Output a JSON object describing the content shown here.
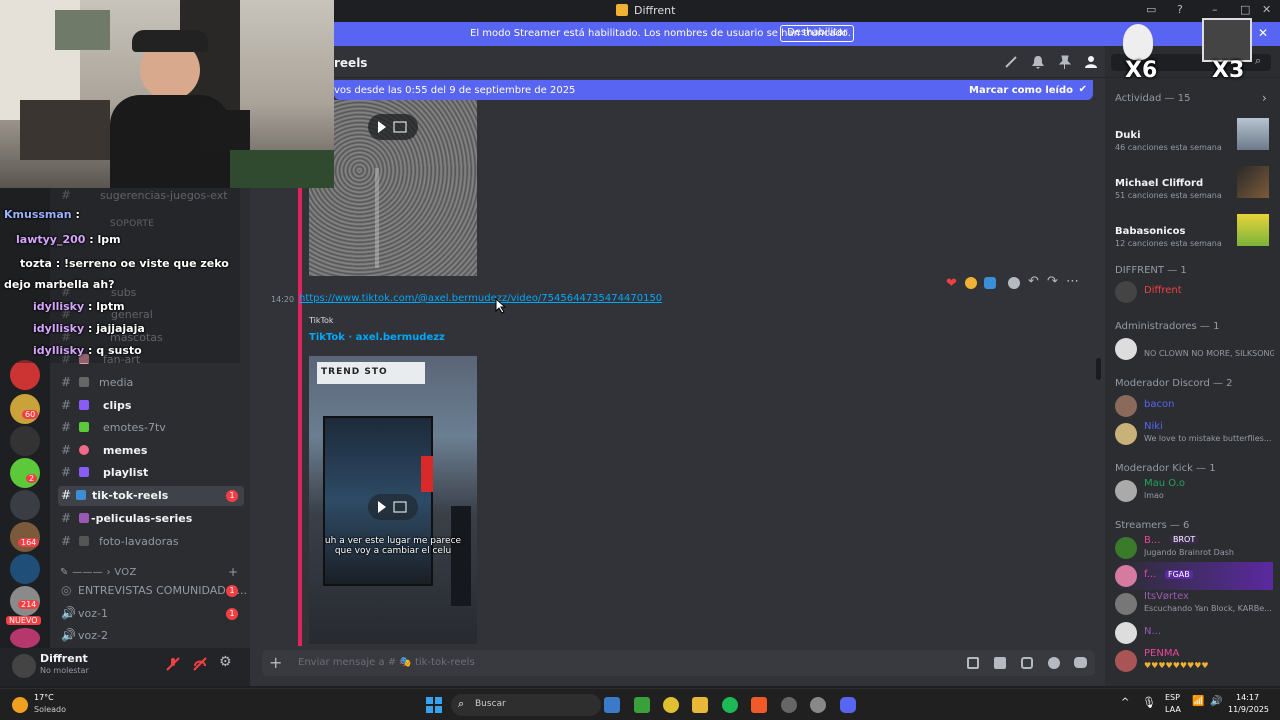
{
  "window": {
    "title": "Diffrent"
  },
  "banner": {
    "message": "El modo Streamer está habilitado. Los nombres de usuario se han truncado.",
    "button": "Deshabilitar"
  },
  "channel_header": {
    "name": "reels"
  },
  "new_messages": {
    "text": "vos desde las 0:55 del 9 de septiembre de 2025",
    "action": "Marcar como leído"
  },
  "message": {
    "time": "14:20",
    "link": "https://www.tiktok.com/@axel.bermudezz/video/7545644735474470150",
    "embed_provider": "TikTok",
    "embed_title": "TikTok · axel.bermudezz",
    "video_caption_line1": "uh a ver este lugar me parece",
    "video_caption_line2": "que voy a cambiar el celu"
  },
  "composer": {
    "placeholder": "Enviar mensaje a # 🎭 tik-tok-reels"
  },
  "overlay_chat": [
    {
      "user": "Kmussman",
      "text": ":"
    },
    {
      "user": "lawtyy_200",
      "text": ": lpm"
    },
    {
      "user": "tozta",
      "text": ": !serreno oe      viste que zeko"
    },
    {
      "user": "",
      "text": "dejo marbella ah?"
    },
    {
      "user": "idyllisky",
      "text": ": lptm"
    },
    {
      "user": "idyllisky",
      "text": ": jajjajaja"
    },
    {
      "user": "idyllisky",
      "text": ": q susto"
    }
  ],
  "sidebar": {
    "cat_soporte": "SOPORTE",
    "cat_voz": "VOZ",
    "channels": [
      {
        "label": "sugerencias-juegos-ext",
        "bold": false
      },
      {
        "label": "subs",
        "bold": false
      },
      {
        "label": "general",
        "bold": false
      },
      {
        "label": "mascotas",
        "bold": false
      },
      {
        "label": "fan-art",
        "bold": false
      },
      {
        "label": "media",
        "bold": false
      },
      {
        "label": "clips",
        "bold": true
      },
      {
        "label": "emotes-7tv",
        "bold": false
      },
      {
        "label": "memes",
        "bold": true
      },
      {
        "label": "playlist",
        "bold": true
      },
      {
        "label": "tik-tok-reels",
        "bold": true
      },
      {
        "label": "-peliculas-series",
        "bold": true
      },
      {
        "label": "foto-lavadoras",
        "bold": false
      }
    ],
    "voice": [
      {
        "label": "ENTREVISTAS COMUNIDAD K...",
        "badge": "1"
      },
      {
        "label": "voz-1",
        "badge": "1"
      },
      {
        "label": "voz-2",
        "badge": ""
      }
    ],
    "unread_badge": "1"
  },
  "user_panel": {
    "name": "Diffrent",
    "status": "No molestar"
  },
  "rail_badges": {
    "b1": "60",
    "b2": "2",
    "b3": "164",
    "b4": "214",
    "nuevo": "NUEVO"
  },
  "members": {
    "activity_header": "Actividad — 15",
    "activities": [
      {
        "name": "Duki",
        "sub": "46 canciones esta semana"
      },
      {
        "name": "Michael Clifford",
        "sub": "51 canciones esta semana"
      },
      {
        "name": "Babasonicos",
        "sub": "12 canciones esta semana"
      }
    ],
    "sections": [
      {
        "title": "DIFFRENT — 1",
        "people": [
          {
            "name": "Diffrent",
            "status": "",
            "color": "#f23f43"
          }
        ]
      },
      {
        "title": "Administradores — 1",
        "people": [
          {
            "name": "",
            "status": "NO CLOWN NO MORE, SILKSONG ...",
            "color": "#5865f2"
          }
        ]
      },
      {
        "title": "Moderador Discord — 2",
        "people": [
          {
            "name": "bacon",
            "status": "",
            "color": "#5865f2"
          },
          {
            "name": "Niki",
            "status": "We love to mistake butterflies...",
            "color": "#5865f2"
          }
        ]
      },
      {
        "title": "Moderador Kick — 1",
        "people": [
          {
            "name": "Mau O.o",
            "status": "lmao",
            "color": "#23a55a"
          }
        ]
      },
      {
        "title": "Streamers — 6",
        "people": [
          {
            "name": "B...",
            "status": "Jugando Brainrot Dash",
            "color": "#eb459e"
          },
          {
            "name": "f...",
            "status": "",
            "color": "#eb459e"
          },
          {
            "name": "ItsVørtex",
            "status": "Escuchando Yan Block, KARBe...",
            "color": "#9b59b6"
          },
          {
            "name": "N...",
            "status": "",
            "color": "#9b59b6"
          },
          {
            "name": "PENMA",
            "status": "♥♥♥♥♥♥♥♥♥",
            "color": "#9b59b6"
          }
        ]
      }
    ],
    "tags": {
      "brot": "BROT",
      "fgab": "FGAB"
    }
  },
  "overlay_counters": {
    "x6": "X6",
    "x3": "X3"
  },
  "taskbar": {
    "weather_temp": "17°C",
    "weather_desc": "Soleado",
    "search": "Buscar",
    "lang1": "ESP",
    "lang2": "LAA",
    "time": "14:17",
    "date": "11/9/2025"
  },
  "colors": {
    "accent": "#5865f2",
    "danger": "#f23f43",
    "link": "#00a8fc"
  }
}
